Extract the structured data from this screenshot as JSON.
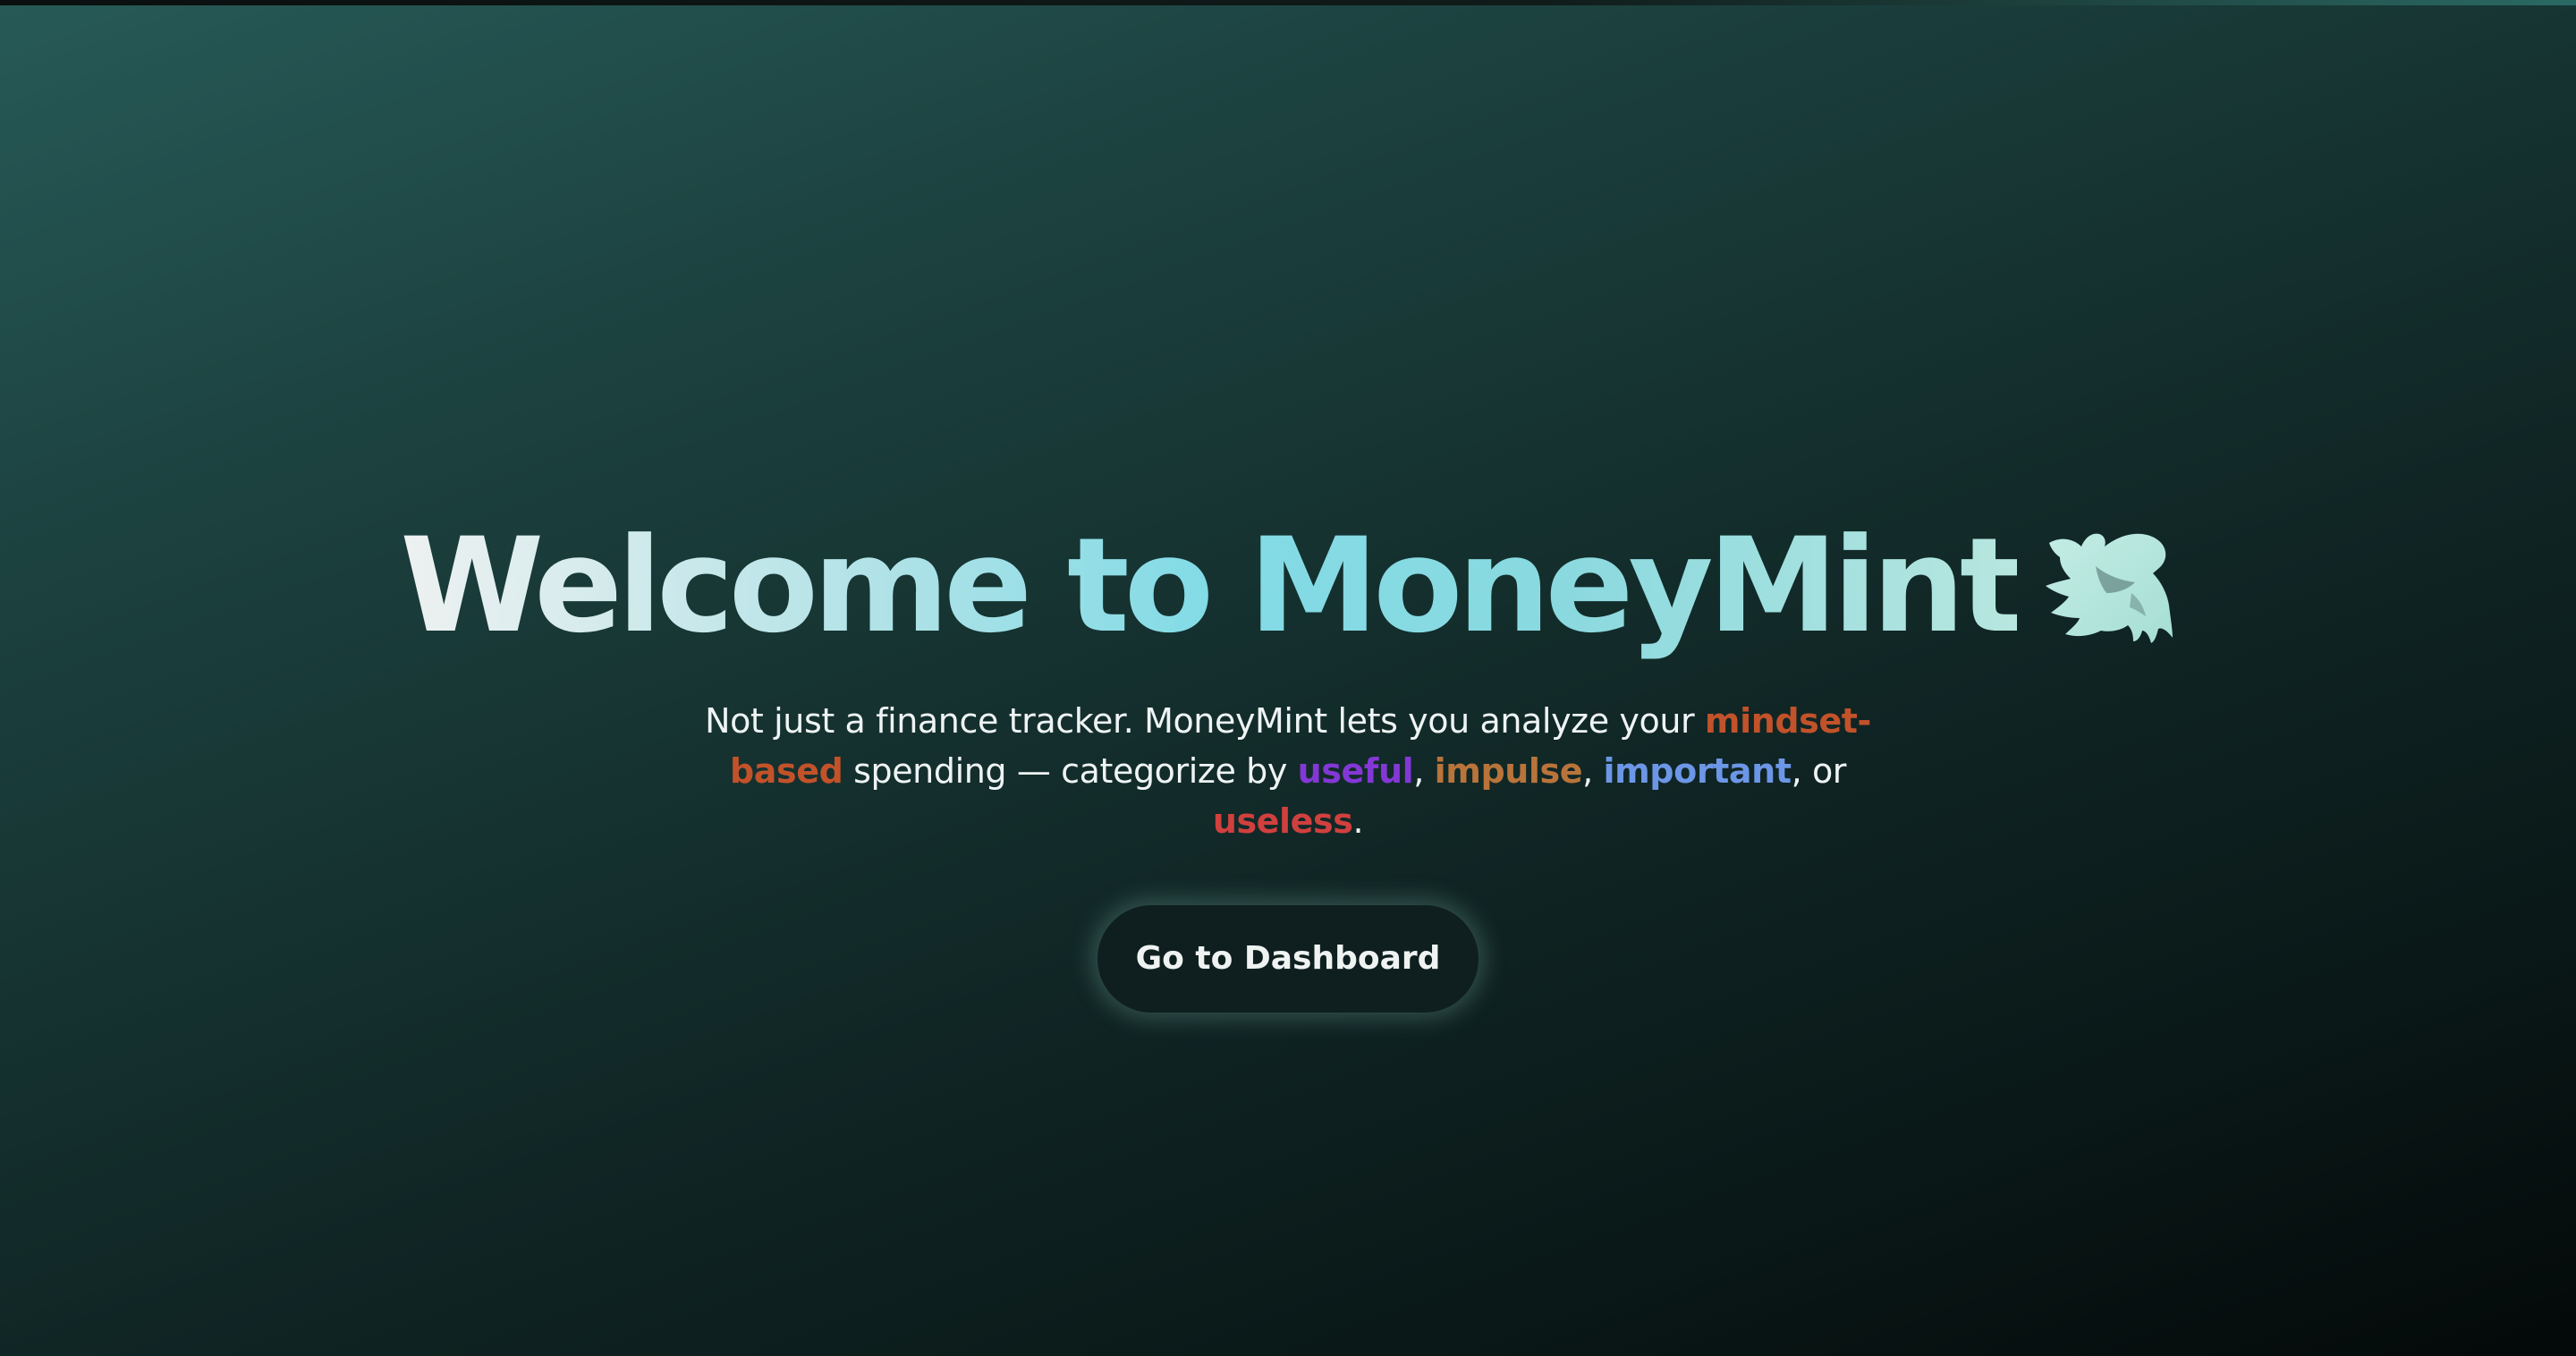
{
  "hero": {
    "title": "Welcome to MoneyMint",
    "title_icon": "dove-icon",
    "subtitle": {
      "intro": "Not just a finance tracker. MoneyMint lets you analyze your ",
      "highlight": "mindset-based",
      "middle": " spending — categorize by ",
      "categories": {
        "useful": "useful",
        "impulse": "impulse",
        "important": "important",
        "useless": "useless"
      },
      "sep1": ", ",
      "sep2": ", ",
      "sep3": ", or ",
      "end": "."
    },
    "cta_label": "Go to Dashboard"
  },
  "colors": {
    "mindset": "#c2522a",
    "useful": "#8338d6",
    "impulse": "#b8743a",
    "important": "#6c96e6",
    "useless": "#d0403e"
  }
}
